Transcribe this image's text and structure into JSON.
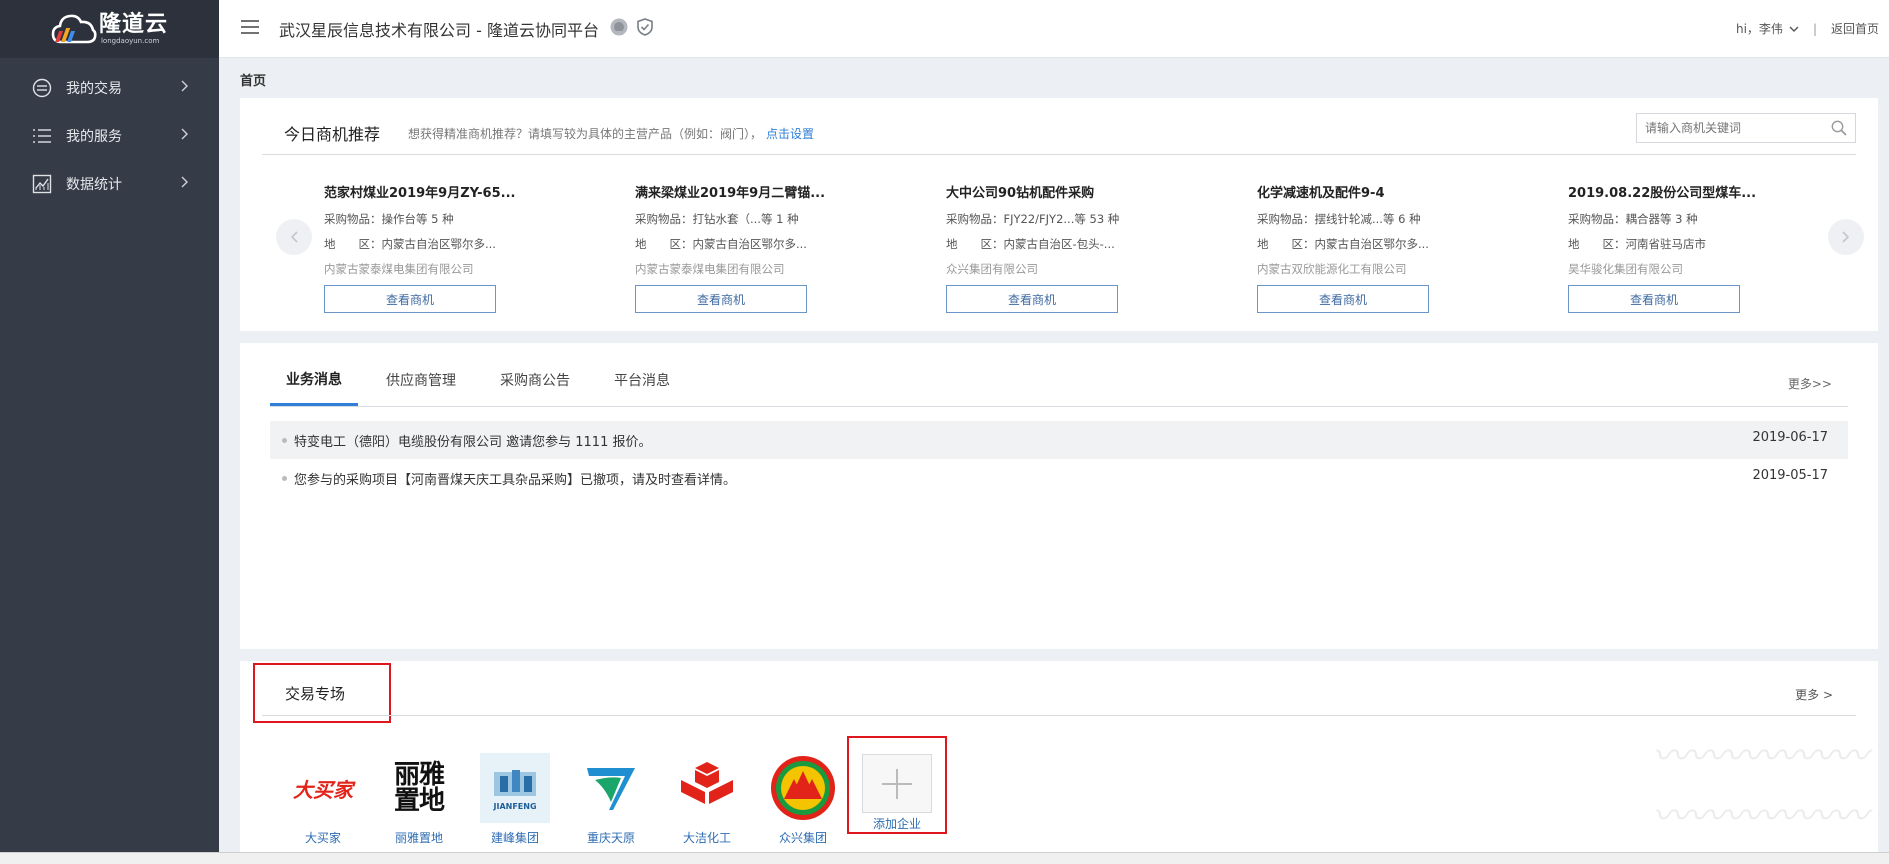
{
  "logo": {
    "name": "隆道云",
    "domain": "longdaoyun.com"
  },
  "sidebar": {
    "items": [
      {
        "label": "我的交易",
        "icon": "exchange-icon"
      },
      {
        "label": "我的服务",
        "icon": "list-icon"
      },
      {
        "label": "数据统计",
        "icon": "chart-icon"
      }
    ]
  },
  "header": {
    "title": "武汉星辰信息技术有限公司 - 隆道云协同平台",
    "user": "hi，李伟",
    "back_link": "返回首页"
  },
  "breadcrumb": "首页",
  "recommend": {
    "title": "今日商机推荐",
    "hint": "想获得精准商机推荐？请填写较为具体的主营产品（例如：阀门），",
    "link": "点击设置",
    "search_placeholder": "请输入商机关键词",
    "button_label": "查看商机",
    "items": [
      {
        "title": "范家村煤业2019年9月ZY-65...",
        "goods_label": "采购物品：",
        "goods": "操作台等 5 种",
        "area_label": "地　　区：",
        "area": "内蒙古自治区鄂尔多...",
        "company": "内蒙古蒙泰煤电集团有限公司"
      },
      {
        "title": "满来梁煤业2019年9月二臂锚...",
        "goods_label": "采购物品：",
        "goods": "打钻水套（...等 1 种",
        "area_label": "地　　区：",
        "area": "内蒙古自治区鄂尔多...",
        "company": "内蒙古蒙泰煤电集团有限公司"
      },
      {
        "title": "大中公司90钻机配件采购",
        "goods_label": "采购物品：",
        "goods": "FJY22/FJY2...等 53 种",
        "area_label": "地　　区：",
        "area": "内蒙古自治区-包头-...",
        "company": "众兴集团有限公司"
      },
      {
        "title": "化学减速机及配件9-4",
        "goods_label": "采购物品：",
        "goods": "摆线针轮减...等 6 种",
        "area_label": "地　　区：",
        "area": "内蒙古自治区鄂尔多...",
        "company": "内蒙古双欣能源化工有限公司"
      },
      {
        "title": "2019.08.22股份公司型煤车...",
        "goods_label": "采购物品：",
        "goods": "耦合器等 3 种",
        "area_label": "地　　区：",
        "area": "河南省驻马店市",
        "company": "昊华骏化集团有限公司"
      }
    ]
  },
  "messages": {
    "tabs": [
      "业务消息",
      "供应商管理",
      "采购商公告",
      "平台消息"
    ],
    "more": "更多>>",
    "items": [
      {
        "text": "特变电工（德阳）电缆股份有限公司 邀请您参与 1111 报价。",
        "date": "2019-06-17"
      },
      {
        "text": "您参与的采购项目【河南晋煤天庆工具杂品采购】已撤项，请及时查看详情。",
        "date": "2019-05-17"
      }
    ]
  },
  "trading": {
    "title": "交易专场",
    "more": "更多 >",
    "companies": [
      {
        "name": "大买家",
        "logo": "大买家"
      },
      {
        "name": "丽雅置地",
        "logo_line1": "丽雅",
        "logo_line2": "置地"
      },
      {
        "name": "建峰集团",
        "logo": "JIANFENG"
      },
      {
        "name": "重庆天原"
      },
      {
        "name": "大洁化工"
      },
      {
        "name": "众兴集团"
      }
    ],
    "add_label": "添加企业"
  },
  "colors": {
    "sidebar": "#353b47",
    "accent": "#2f7fd6",
    "highlight_border": "#e0161e"
  }
}
